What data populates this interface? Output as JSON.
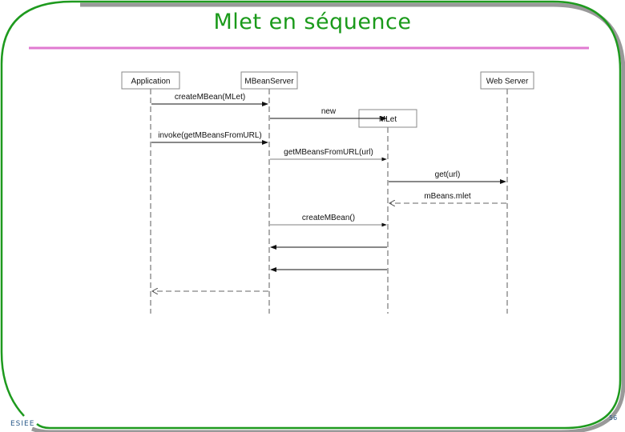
{
  "slide": {
    "title": "Mlet en séquence",
    "footer_left": "ESIEE",
    "page_number": "56",
    "colors": {
      "frame": "#1e9a1e",
      "title": "#1a9a1a",
      "rule": "#e07ad0",
      "shadow": "#999999"
    }
  },
  "diagram": {
    "type": "sequence",
    "participants": [
      {
        "id": "app",
        "label": "Application"
      },
      {
        "id": "server",
        "label": "MBeanServer"
      },
      {
        "id": "mlet",
        "label": "MLet"
      },
      {
        "id": "web",
        "label": "Web Server"
      }
    ],
    "messages": [
      {
        "from": "app",
        "to": "server",
        "label": "createMBean(MLet)",
        "style": "solid"
      },
      {
        "from": "server",
        "to": "mlet",
        "label": "new",
        "style": "solid"
      },
      {
        "from": "app",
        "to": "server",
        "label": "invoke(getMBeansFromURL)",
        "style": "solid"
      },
      {
        "from": "server",
        "to": "mlet",
        "label": "getMBeansFromURL(url)",
        "style": "solid"
      },
      {
        "from": "mlet",
        "to": "web",
        "label": "get(url)",
        "style": "solid"
      },
      {
        "from": "web",
        "to": "mlet",
        "label": "mBeans.mlet",
        "style": "dashed-return"
      },
      {
        "from": "server",
        "to": "mlet",
        "label": "createMBean()",
        "style": "solid"
      },
      {
        "from": "mlet",
        "to": "server",
        "label": "",
        "style": "solid"
      },
      {
        "from": "mlet",
        "to": "server",
        "label": "",
        "style": "solid"
      },
      {
        "from": "server",
        "to": "app",
        "label": "",
        "style": "dashed-return"
      }
    ]
  }
}
